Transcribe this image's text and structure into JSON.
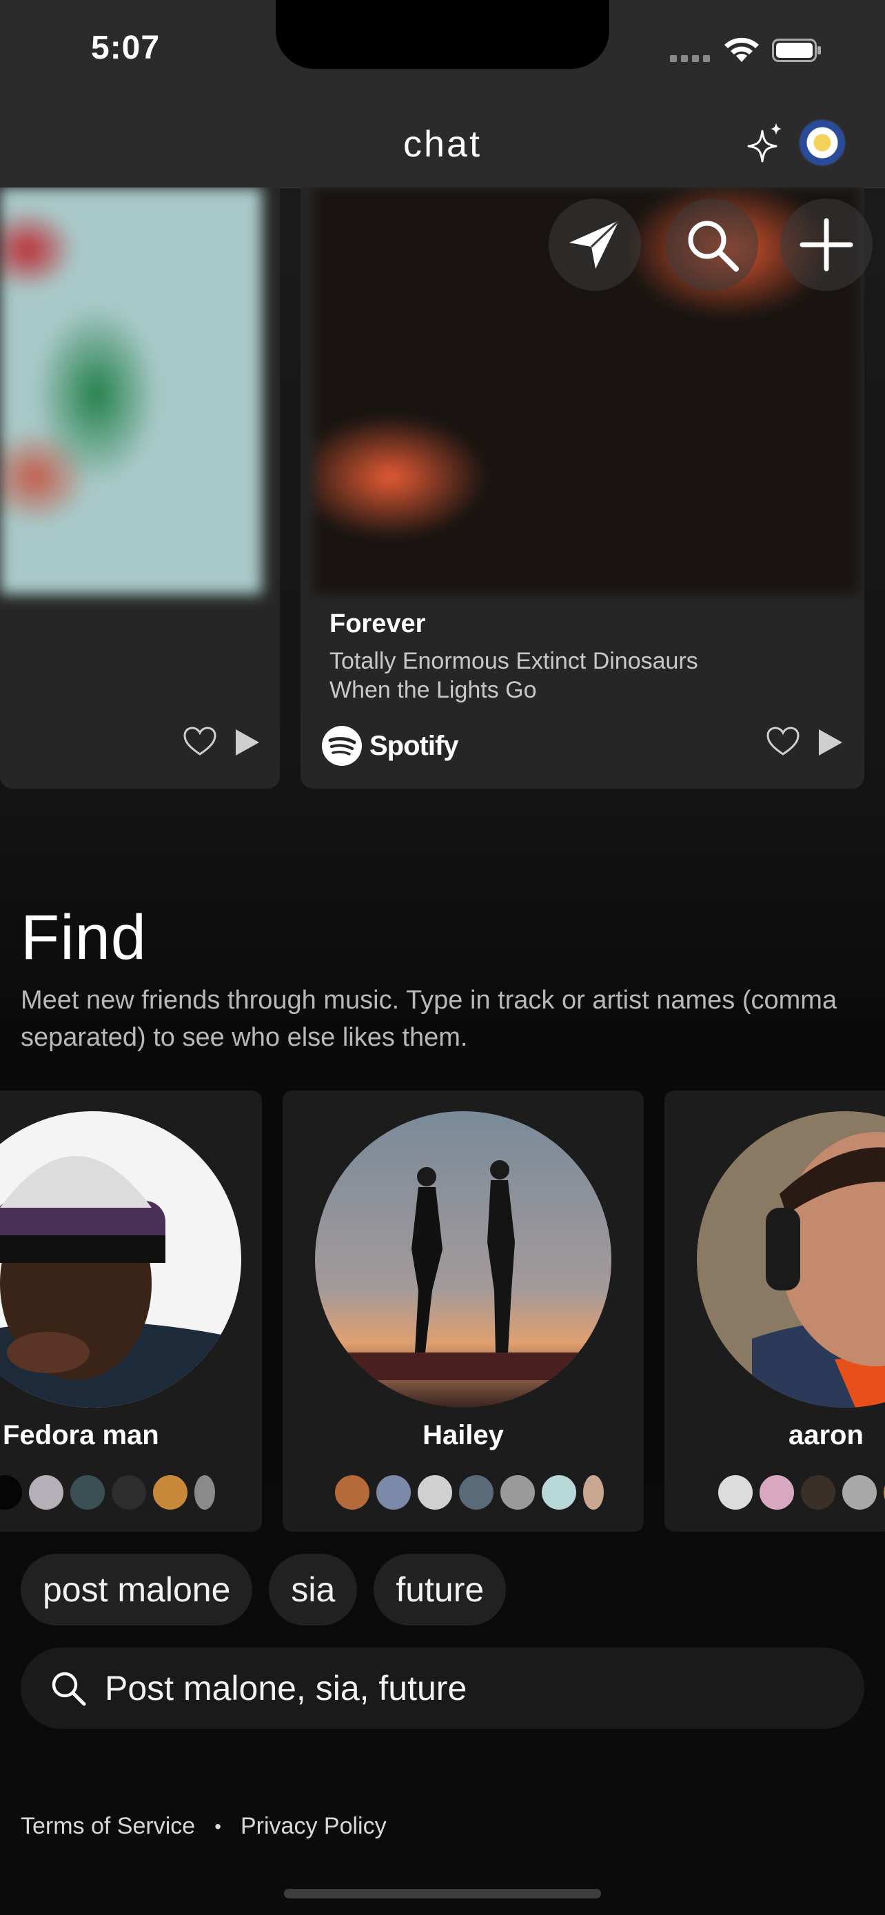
{
  "status_bar": {
    "time": "5:07"
  },
  "header": {
    "title": "chat",
    "sparkle_icon": "sparkle-icon",
    "avatar_icon": "profile-avatar"
  },
  "music_cards": [
    {
      "title": "",
      "subtitle_1": "",
      "subtitle_2": ""
    },
    {
      "title": "Forever",
      "subtitle_1": "Totally Enormous Extinct Dinosaurs",
      "subtitle_2": "When the Lights Go",
      "provider": "Spotify"
    }
  ],
  "actions": {
    "send_icon": "send-icon",
    "search_icon": "search-icon",
    "add_icon": "plus-icon"
  },
  "find": {
    "title": "Find",
    "description": "Meet new friends through music. Type in track or artist names (comma separated) to see who else likes them."
  },
  "people": [
    {
      "name": "Fedora man"
    },
    {
      "name": "Hailey"
    },
    {
      "name": "aaron"
    }
  ],
  "chips": [
    "post malone",
    "sia",
    "future"
  ],
  "search": {
    "value": "Post malone, sia, future"
  },
  "footer": {
    "terms": "Terms of Service",
    "separator": "•",
    "privacy": "Privacy Policy"
  },
  "colors": {
    "background": "#0c0c0c",
    "header": "#2b2b2b",
    "card": "#262626",
    "chip": "#212121",
    "accent_spotify": "#ffffff"
  }
}
